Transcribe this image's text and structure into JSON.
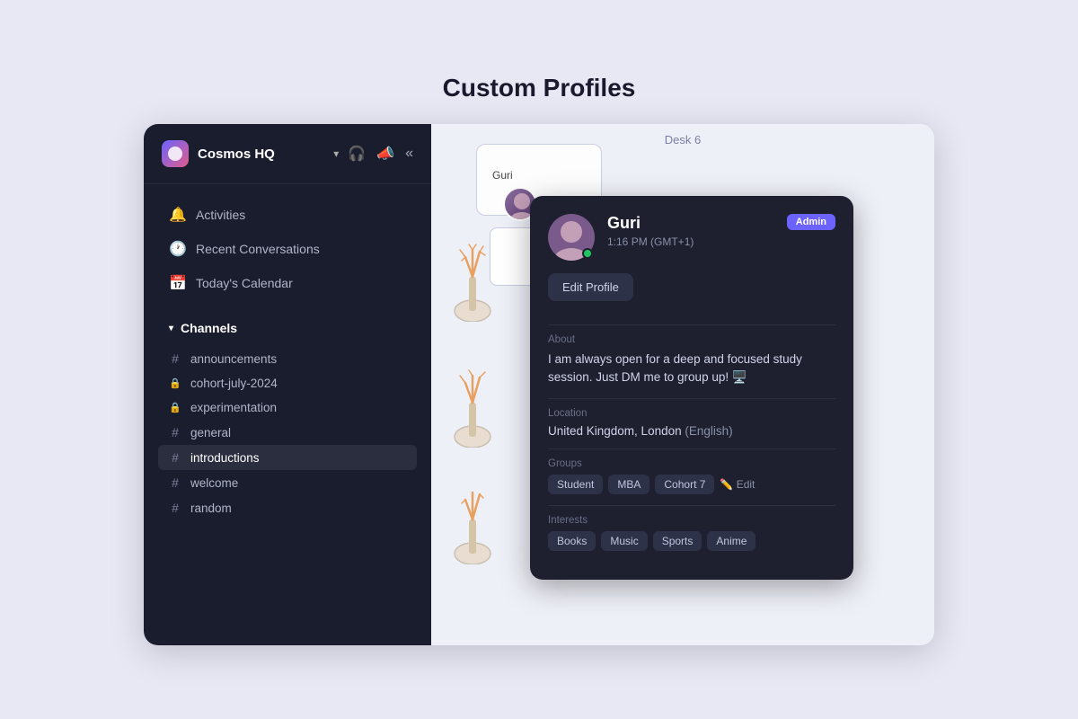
{
  "page": {
    "title": "Custom Profiles",
    "background_color": "#e8e8f5"
  },
  "sidebar": {
    "workspace_name": "Cosmos HQ",
    "nav_items": [
      {
        "id": "activities",
        "label": "Activities",
        "icon": "🔔"
      },
      {
        "id": "recent_conversations",
        "label": "Recent Conversations",
        "icon": "🕐"
      },
      {
        "id": "todays_calendar",
        "label": "Today's Calendar",
        "icon": "📅"
      }
    ],
    "channels_label": "Channels",
    "channels": [
      {
        "id": "announcements",
        "label": "announcements",
        "type": "public"
      },
      {
        "id": "cohort-july-2024",
        "label": "cohort-july-2024",
        "type": "private"
      },
      {
        "id": "experimentation",
        "label": "experimentation",
        "type": "private"
      },
      {
        "id": "general",
        "label": "general",
        "type": "public"
      },
      {
        "id": "introductions",
        "label": "introductions",
        "type": "public"
      },
      {
        "id": "welcome",
        "label": "welcome",
        "type": "public"
      },
      {
        "id": "random",
        "label": "random",
        "type": "public"
      }
    ]
  },
  "desk": {
    "label": "Desk 6",
    "user_label": "Guri"
  },
  "user_card": {
    "name": "Guri",
    "time": "1:16 PM (GMT+1)",
    "admin_badge": "Admin",
    "edit_profile_label": "Edit Profile",
    "about_label": "About",
    "about_text": "I am always open for a deep and focused study session. Just DM me to group up! 🖥️",
    "location_label": "Location",
    "location_text": "United Kingdom, London",
    "location_secondary": "(English)",
    "groups_label": "Groups",
    "groups": [
      {
        "id": "student",
        "label": "Student"
      },
      {
        "id": "mba",
        "label": "MBA"
      },
      {
        "id": "cohort7",
        "label": "Cohort 7"
      }
    ],
    "groups_edit_label": "✏️ Edit",
    "interests_label": "Interests",
    "interests": [
      {
        "id": "books",
        "label": "Books"
      },
      {
        "id": "music",
        "label": "Music"
      },
      {
        "id": "sports",
        "label": "Sports"
      },
      {
        "id": "anime",
        "label": "Anime"
      }
    ]
  }
}
